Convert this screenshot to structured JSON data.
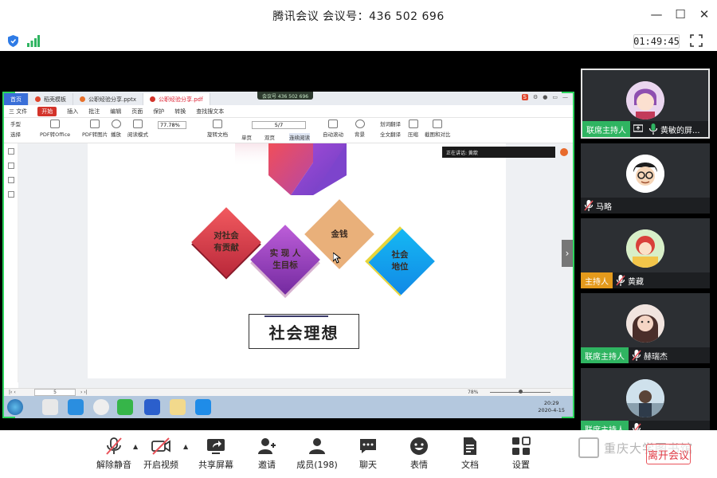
{
  "window": {
    "title": "腾讯会议 会议号：436 502 696",
    "controls": [
      "—",
      "☐",
      "✕"
    ]
  },
  "status": {
    "timer": "01:49:45"
  },
  "shared_screen": {
    "wps_tabs": [
      "首页",
      "稻壳模板",
      "公职经验分享.pptx",
      "公职经验分享.pdf"
    ],
    "meeting_chip": "会议号 436 502 696",
    "menu": [
      "三 文件",
      "开始",
      "插入",
      "批注",
      "编辑",
      "页面",
      "保护",
      "转换",
      "查找搜文本"
    ],
    "toolbar": {
      "hand": "手型",
      "select": "选择",
      "pdf_to_office": "PDF转Office",
      "pdf_to_image": "PDF转图片",
      "play": "播放",
      "read_mode": "阅读模式",
      "zoom": "77.78%",
      "page": "5/7",
      "rotate": "旋转文档",
      "single": "单页",
      "double": "双页",
      "continuous": "连续阅读",
      "auto_scroll": "自动滚动",
      "background": "背景",
      "translate": "划词翻译",
      "full_translate": "全文翻译",
      "compress": "压缩",
      "screenshot": "截图和对比"
    },
    "speaking_label": "正在讲话: 黄歆",
    "slide": {
      "diamonds": [
        "对社会有贡献",
        "实现人生目标",
        "金钱",
        "社会地位"
      ],
      "diamond_lines": [
        [
          "对社会",
          "有贡献"
        ],
        [
          "实 现 人",
          "生目标"
        ],
        [
          "金钱"
        ],
        [
          "社会",
          "地位"
        ]
      ],
      "title": "社会理想"
    },
    "viewer_status": {
      "page": "5",
      "zoom": "78%"
    },
    "taskbar": {
      "time": "20:29",
      "date": "2020-4-15"
    }
  },
  "participants": [
    {
      "role": "联席主持人",
      "name": "黄敏的屏..."
    },
    {
      "role": "",
      "name": "马略"
    },
    {
      "role": "主持人",
      "name": "黄藏"
    },
    {
      "role": "联席主持人",
      "name": "赫瑞杰"
    },
    {
      "role": "联席主持人",
      "name": ""
    }
  ],
  "bottom_toolbar": [
    {
      "label": "解除静音"
    },
    {
      "label": "开启视频"
    },
    {
      "label": "共享屏幕"
    },
    {
      "label": "邀请"
    },
    {
      "label": "成员(198)"
    },
    {
      "label": "聊天"
    },
    {
      "label": "表情"
    },
    {
      "label": "文档"
    },
    {
      "label": "设置"
    }
  ],
  "watermark": "重庆大学图书馆",
  "leave_button": "离开会议",
  "colors": {
    "accent_green": "#2bd45c",
    "role_green": "#2fb461",
    "role_orange": "#e49a1c",
    "leave_red": "#e03a44"
  }
}
